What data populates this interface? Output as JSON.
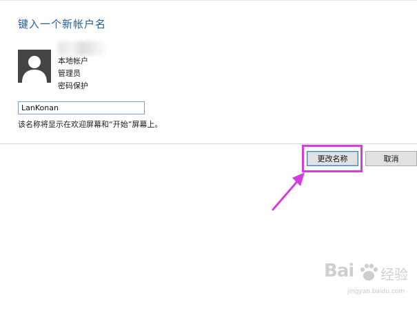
{
  "dialog": {
    "title": "键入一个新帐户名"
  },
  "account": {
    "type": "本地帐户",
    "role": "管理员",
    "protection": "密码保护"
  },
  "name_input": {
    "value": "LanKonan"
  },
  "hint": "该名称将显示在欢迎屏幕和“开始”屏幕上。",
  "buttons": {
    "rename_label": "更改名称",
    "cancel_label": "取消"
  },
  "annotation": {
    "color": "#d63be0"
  },
  "watermark": {
    "logo": "Bai",
    "brand": "经验",
    "url": "jingyan.baidu.com"
  }
}
